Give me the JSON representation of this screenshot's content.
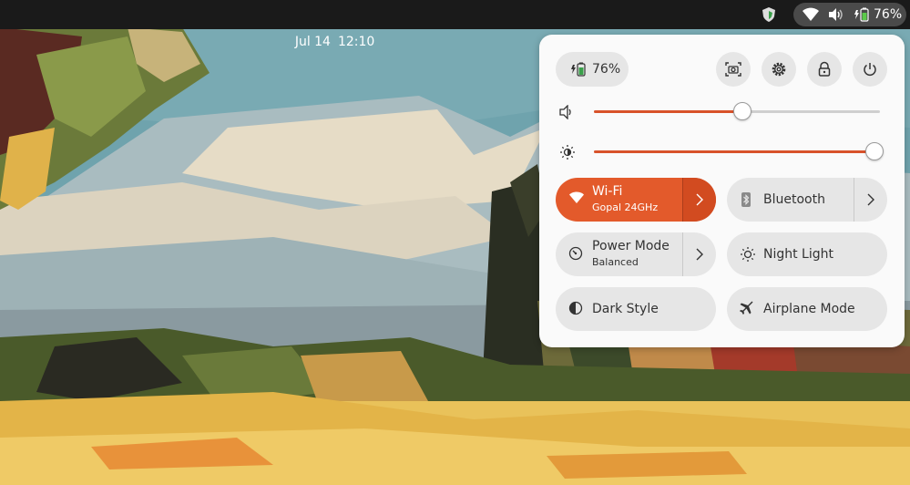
{
  "topbar": {
    "date": "Jul 14",
    "time": "12:10",
    "battery_percent": "76%"
  },
  "quick_settings": {
    "battery_label": "76%",
    "volume_level": 0.52,
    "brightness_level": 0.98,
    "tiles": {
      "wifi": {
        "title": "Wi-Fi",
        "subtitle": "Gopal 24GHz",
        "active": true
      },
      "bluetooth": {
        "title": "Bluetooth",
        "active": false
      },
      "power_mode": {
        "title": "Power Mode",
        "subtitle": "Balanced",
        "active": false
      },
      "night_light": {
        "title": "Night Light",
        "active": false
      },
      "dark_style": {
        "title": "Dark Style",
        "active": false
      },
      "airplane_mode": {
        "title": "Airplane Mode",
        "active": false
      }
    },
    "buttons": [
      "screenshot-icon",
      "settings-icon",
      "lock-icon",
      "power-icon"
    ]
  },
  "colors": {
    "accent": "#e35a2b",
    "topbar": "#1a1a1a",
    "panel": "#fafafa",
    "tile": "#e6e6e6"
  }
}
